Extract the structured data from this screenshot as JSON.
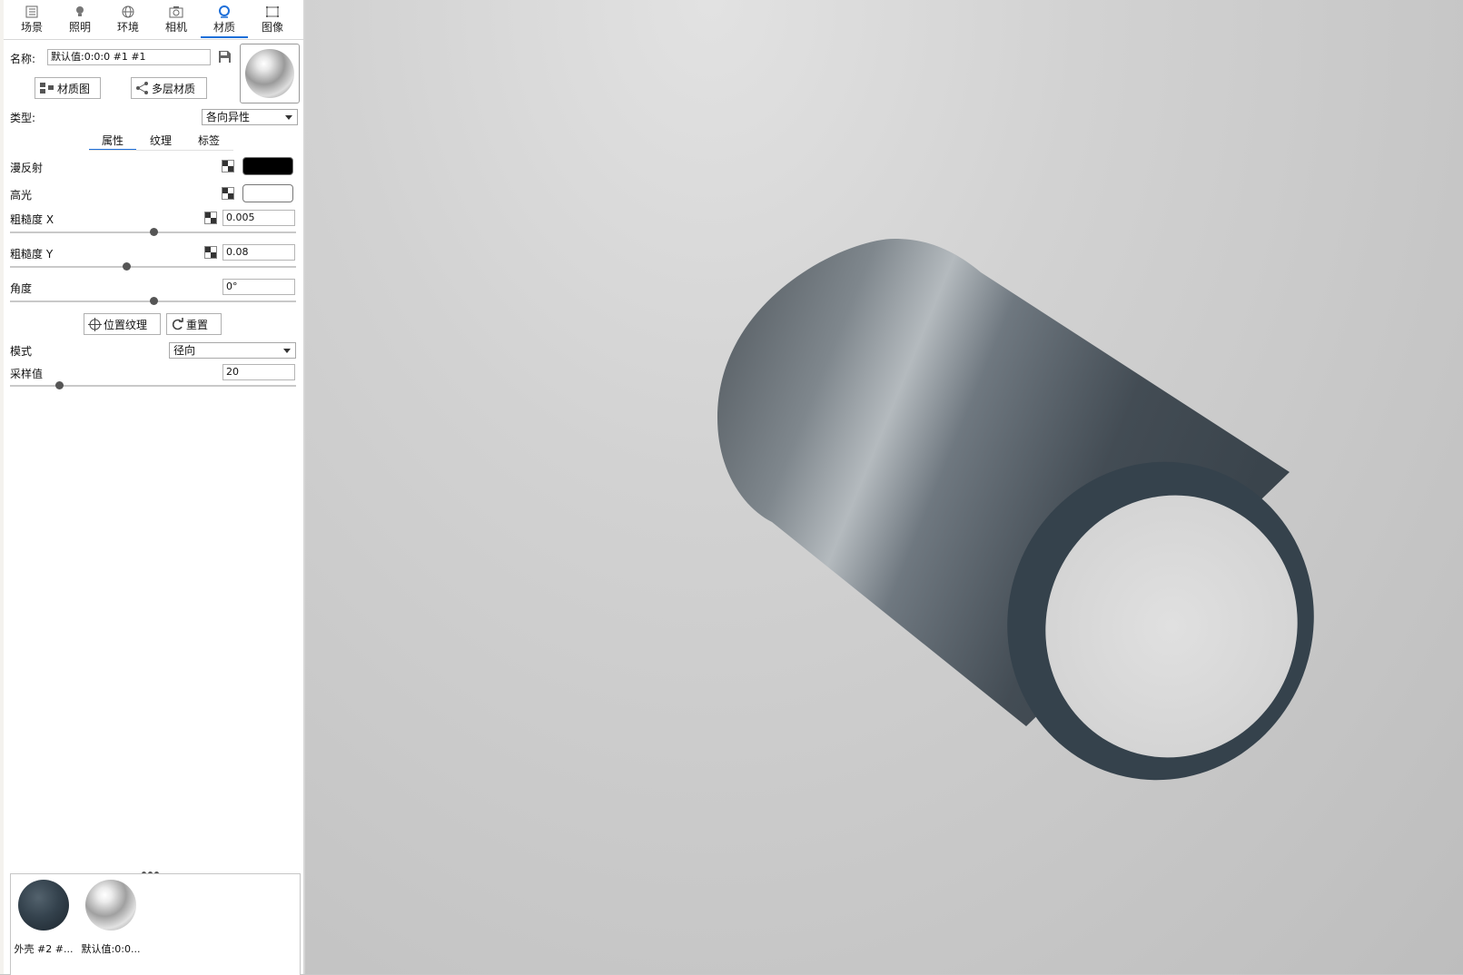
{
  "tabs": [
    {
      "label": "场景",
      "icon": "scene-icon"
    },
    {
      "label": "照明",
      "icon": "bulb-icon"
    },
    {
      "label": "环境",
      "icon": "globe-icon"
    },
    {
      "label": "相机",
      "icon": "camera-icon"
    },
    {
      "label": "材质",
      "icon": "material-icon",
      "active": true
    },
    {
      "label": "图像",
      "icon": "image-icon"
    }
  ],
  "name": {
    "label": "名称:",
    "value": "默认值:0:0:0 #1 #1"
  },
  "buttons": {
    "material_graph": "材质图",
    "multilayer": "多层材质",
    "place_texture": "位置纹理",
    "reset": "重置"
  },
  "type": {
    "label": "类型:",
    "value": "各向异性"
  },
  "subtabs": [
    "属性",
    "纹理",
    "标签"
  ],
  "props": {
    "diffuse": {
      "label": "漫反射",
      "color": "#000000"
    },
    "specular": {
      "label": "高光",
      "color": "#ffffff"
    },
    "roughness_x": {
      "label": "粗糙度 X",
      "value": "0.005",
      "slider": 0.5
    },
    "roughness_y": {
      "label": "粗糙度 Y",
      "value": "0.08",
      "slider": 0.4
    },
    "angle": {
      "label": "角度",
      "value": "0°",
      "slider": 0.5
    },
    "mode": {
      "label": "模式",
      "value": "径向"
    },
    "samples": {
      "label": "采样值",
      "value": "20",
      "slider": 0.17
    }
  },
  "library": [
    {
      "label": "外壳 #2 #...",
      "color": "#2f3c47"
    },
    {
      "label": "默认值:0:0...",
      "color": "#c8c8c8"
    }
  ]
}
